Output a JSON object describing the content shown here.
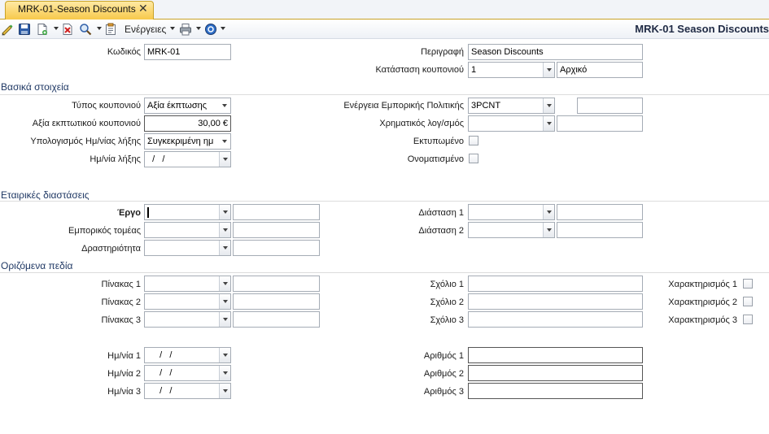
{
  "tab": {
    "label": "MRK-01-Season Discounts",
    "close": "✕"
  },
  "toolbar": {
    "actions_label": "Ενέργειες",
    "icons": [
      "edit-icon",
      "save-icon",
      "new-doc-icon",
      "delete-icon",
      "search-icon",
      "copy-icon",
      "print-icon",
      "help-icon"
    ]
  },
  "window_title": "MRK-01 Season Discounts",
  "header": {
    "code_label": "Κωδικός",
    "code_value": "MRK-01",
    "desc_label": "Περιγραφή",
    "desc_value": "Season Discounts",
    "status_label": "Κατάσταση κουπονιού",
    "status_code": "1",
    "status_text": "Αρχικό"
  },
  "basic": {
    "title": "Βασικά στοιχεία",
    "type_label": "Τύπος κουπονιού",
    "type_value": "Αξία έκπτωσης",
    "value_label": "Αξία εκπτωτικού κουπονιού",
    "value_value": "30,00 €",
    "calc_label": "Υπολογισμός Ημ/νίας λήξης",
    "calc_value": "Συγκεκριμένη ημ",
    "expiry_label": "Ημ/νία λήξης",
    "expiry_value": "  /   /",
    "policy_label": "Ενέργεια Εμπορικής Πολιτικής",
    "policy_value": "3PCNT",
    "policy_extra": "",
    "account_label": "Χρηματικός λογ/σμός",
    "account_value": "",
    "account_extra": "",
    "printed_label": "Εκτυπωμένο",
    "named_label": "Ονοματισμένο"
  },
  "corporate": {
    "title": "Εταιρικές διαστάσεις",
    "project_label": "Έργο",
    "sector_label": "Εμπορικός τομέας",
    "activity_label": "Δραστηριότητα",
    "dim1_label": "Διάσταση 1",
    "dim2_label": "Διάσταση 2"
  },
  "custom": {
    "title": "Οριζόμενα πεδία",
    "table1_label": "Πίνακας 1",
    "table2_label": "Πίνακας 2",
    "table3_label": "Πίνακας 3",
    "comment1_label": "Σχόλιο 1",
    "comment2_label": "Σχόλιο 2",
    "comment3_label": "Σχόλιο 3",
    "char1_label": "Χαρακτηρισμός 1",
    "char2_label": "Χαρακτηρισμός 2",
    "char3_label": "Χαρακτηρισμός 3",
    "date1_label": "Ημ/νία 1",
    "date2_label": "Ημ/νία 2",
    "date3_label": "Ημ/νία 3",
    "date1_value": "  /   /",
    "date2_value": "  /   /",
    "date3_value": "  /   /",
    "num1_label": "Αριθμός 1",
    "num2_label": "Αριθμός 2",
    "num3_label": "Αριθμός 3"
  },
  "colors": {
    "tab_active": "#f7c94b",
    "section_title": "#1f3864",
    "field_border": "#a5acb5"
  }
}
